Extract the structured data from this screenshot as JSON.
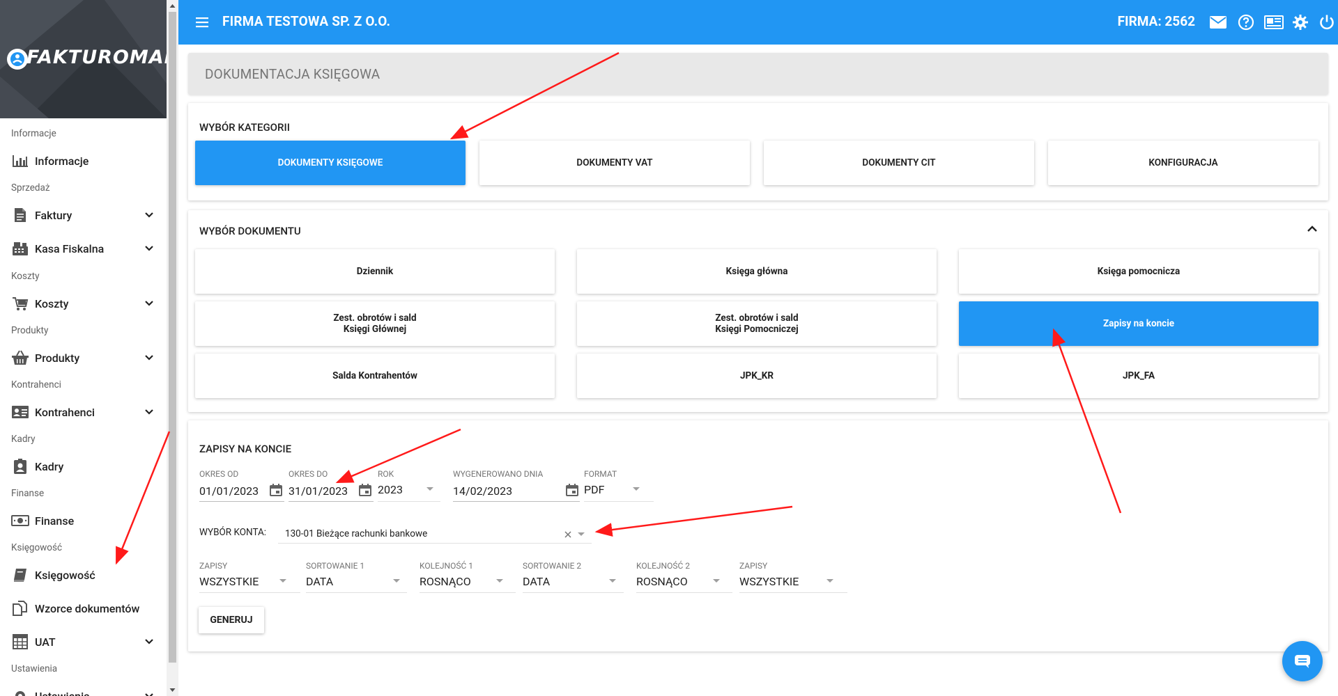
{
  "app": {
    "logo_text": "FAKTUROMANIA",
    "company_title": "FIRMA TESTOWA SP. Z O.O.",
    "firma_label": "FIRMA: 2562"
  },
  "colors": {
    "primary": "#2196f3",
    "annotation_arrow": "#ff1a1a"
  },
  "sidebar": {
    "sections": [
      {
        "label": "Informacje"
      },
      {
        "label": "Sprzedaż"
      },
      {
        "label": "Koszty"
      },
      {
        "label": "Produkty"
      },
      {
        "label": "Kontrahenci"
      },
      {
        "label": "Kadry"
      },
      {
        "label": "Finanse"
      },
      {
        "label": "Księgowość"
      },
      {
        "label": "Ustawienia"
      }
    ],
    "items": [
      {
        "label": "Informacje",
        "icon": "bar-chart-icon"
      },
      {
        "label": "Faktury",
        "icon": "document-icon"
      },
      {
        "label": "Kasa Fiskalna",
        "icon": "cash-register-icon"
      },
      {
        "label": "Koszty",
        "icon": "cart-icon"
      },
      {
        "label": "Produkty",
        "icon": "basket-icon"
      },
      {
        "label": "Kontrahenci",
        "icon": "id-card-icon"
      },
      {
        "label": "Kadry",
        "icon": "person-badge-icon"
      },
      {
        "label": "Finanse",
        "icon": "money-icon"
      },
      {
        "label": "Księgowość",
        "icon": "book-icon"
      },
      {
        "label": "Wzorce dokumentów",
        "icon": "copy-documents-icon"
      },
      {
        "label": "UAT",
        "icon": "calculator-icon"
      },
      {
        "label": "Ustawienia",
        "icon": "gear-icon"
      }
    ]
  },
  "page": {
    "title": "DOKUMENTACJA KSIĘGOWA"
  },
  "category": {
    "title": "WYBÓR KATEGORII",
    "tiles": [
      "DOKUMENTY KSIĘGOWE",
      "DOKUMENTY VAT",
      "DOKUMENTY CIT",
      "KONFIGURACJA"
    ],
    "active": "DOKUMENTY KSIĘGOWE"
  },
  "documents": {
    "title": "WYBÓR DOKUMENTU",
    "tiles": [
      "Dziennik",
      "Księga główna",
      "Księga pomocnicza",
      "Zest. obrotów i sald\nKsięgi Głównej",
      "Zest. obrotów i sald\nKsięgi Pomocniczej",
      "Zapisy na koncie",
      "Salda Kontrahentów",
      "JPK_KR",
      "JPK_FA"
    ],
    "active": "Zapisy na koncie"
  },
  "form": {
    "title": "ZAPISY NA KONCIE",
    "okres_od_label": "OKRES OD",
    "okres_od_value": "01/01/2023",
    "okres_do_label": "OKRES DO",
    "okres_do_value": "31/01/2023",
    "rok_label": "ROK",
    "rok_value": "2023",
    "wygenerowano_label": "WYGENEROWANO DNIA",
    "wygenerowano_value": "14/02/2023",
    "format_label": "FORMAT",
    "format_value": "PDF",
    "konto_label": "WYBÓR KONTA:",
    "konto_value": "130-01 Bieżące rachunki bankowe",
    "zapisy_label": "ZAPISY",
    "zapisy_value": "WSZYSTKIE",
    "sort1_label": "SORTOWANIE 1",
    "sort1_value": "DATA",
    "kol1_label": "KOLEJNOŚĆ 1",
    "kol1_value": "ROSNĄCO",
    "sort2_label": "SORTOWANIE 2",
    "sort2_value": "DATA",
    "kol2_label": "KOLEJNOŚĆ 2",
    "kol2_value": "ROSNĄCO",
    "zapisy2_label": "ZAPISY",
    "zapisy2_value": "WSZYSTKIE",
    "generate_label": "GENERUJ"
  }
}
